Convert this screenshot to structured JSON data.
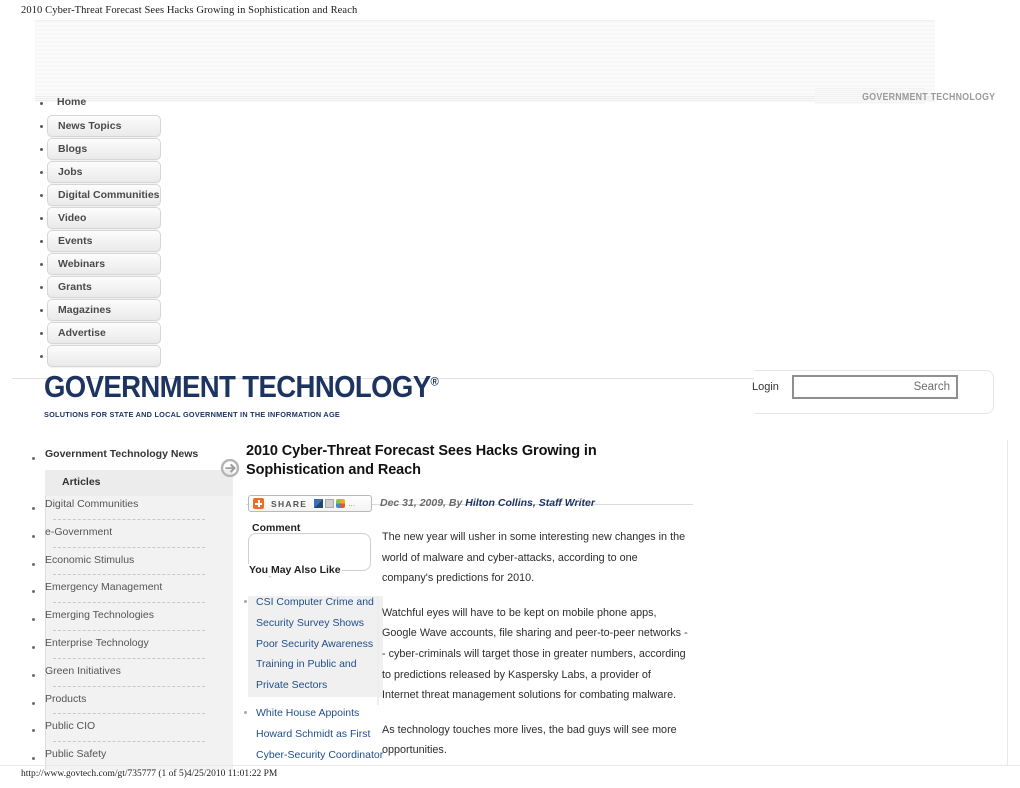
{
  "page_header": "2010 Cyber-Threat Forecast Sees Hacks Growing in Sophistication and Reach",
  "topnav": {
    "items": [
      {
        "label": "Home",
        "style": "plain"
      },
      {
        "label": "News Topics",
        "style": "button"
      },
      {
        "label": "Blogs",
        "style": "button"
      },
      {
        "label": "Jobs",
        "style": "button"
      },
      {
        "label": "Digital Communities",
        "style": "button"
      },
      {
        "label": "Video",
        "style": "button"
      },
      {
        "label": "Events",
        "style": "button"
      },
      {
        "label": "Webinars",
        "style": "button"
      },
      {
        "label": "Grants",
        "style": "button"
      },
      {
        "label": "Magazines",
        "style": "button"
      },
      {
        "label": "Advertise",
        "style": "button"
      },
      {
        "label": "",
        "style": "button"
      }
    ]
  },
  "corner_wordmark": "GOVERNMENT TECHNOLOGY",
  "masthead": {
    "logo": "GOVERNMENT TECHNOLOGY",
    "logo_mark": "®",
    "tagline": "SOLUTIONS FOR STATE AND LOCAL GOVERNMENT IN THE INFORMATION AGE",
    "logo_color": "#1d3461",
    "login_label": "Login",
    "search_value": "Search",
    "search_placeholder": "Search"
  },
  "sidebar": {
    "title": "Government Technology News",
    "active_item": "Articles",
    "items": [
      {
        "label": "Digital Communities"
      },
      {
        "label": "e-Government"
      },
      {
        "label": "Economic Stimulus"
      },
      {
        "label": "Emergency Management"
      },
      {
        "label": "Emerging Technologies"
      },
      {
        "label": "Enterprise Technology"
      },
      {
        "label": "Green Initiatives"
      },
      {
        "label": "Products"
      },
      {
        "label": "Public CIO"
      },
      {
        "label": "Public Safety"
      }
    ]
  },
  "article": {
    "headline": "2010 Cyber-Threat Forecast Sees Hacks Growing in Sophistication and Reach",
    "share_label": "SHARE",
    "share_more": "...",
    "byline_date": "Dec 31, 2009, By ",
    "byline_author": "Hilton Collins, Staff Writer",
    "paragraphs": [
      "The new year will usher in some interesting new changes in the world of malware and cyber-attacks, according to one company's predictions for 2010.",
      "Watchful eyes will have to be kept on mobile phone apps, Google Wave accounts, file sharing and peer-to-peer networks -- cyber-criminals will target those in greater numbers, according to predictions released by Kaspersky Labs, a provider of Internet threat management solutions for combating malware.",
      "As technology touches more lives, the bad guys will see more opportunities."
    ]
  },
  "aside": {
    "comment_label": "Comment",
    "comment_value": "",
    "you_may_also_like_label": "You May Also Like",
    "related": [
      {
        "label": "CSI Computer Crime and Security Survey Shows Poor Security Awareness Training in Public and Private Sectors"
      },
      {
        "label": "White House Appoints Howard Schmidt as First Cyber-Security Coordinator"
      }
    ]
  },
  "footer": {
    "text": "http://www.govtech.com/gt/735777 (1 of 5)4/25/2010 11:01:22 PM"
  }
}
